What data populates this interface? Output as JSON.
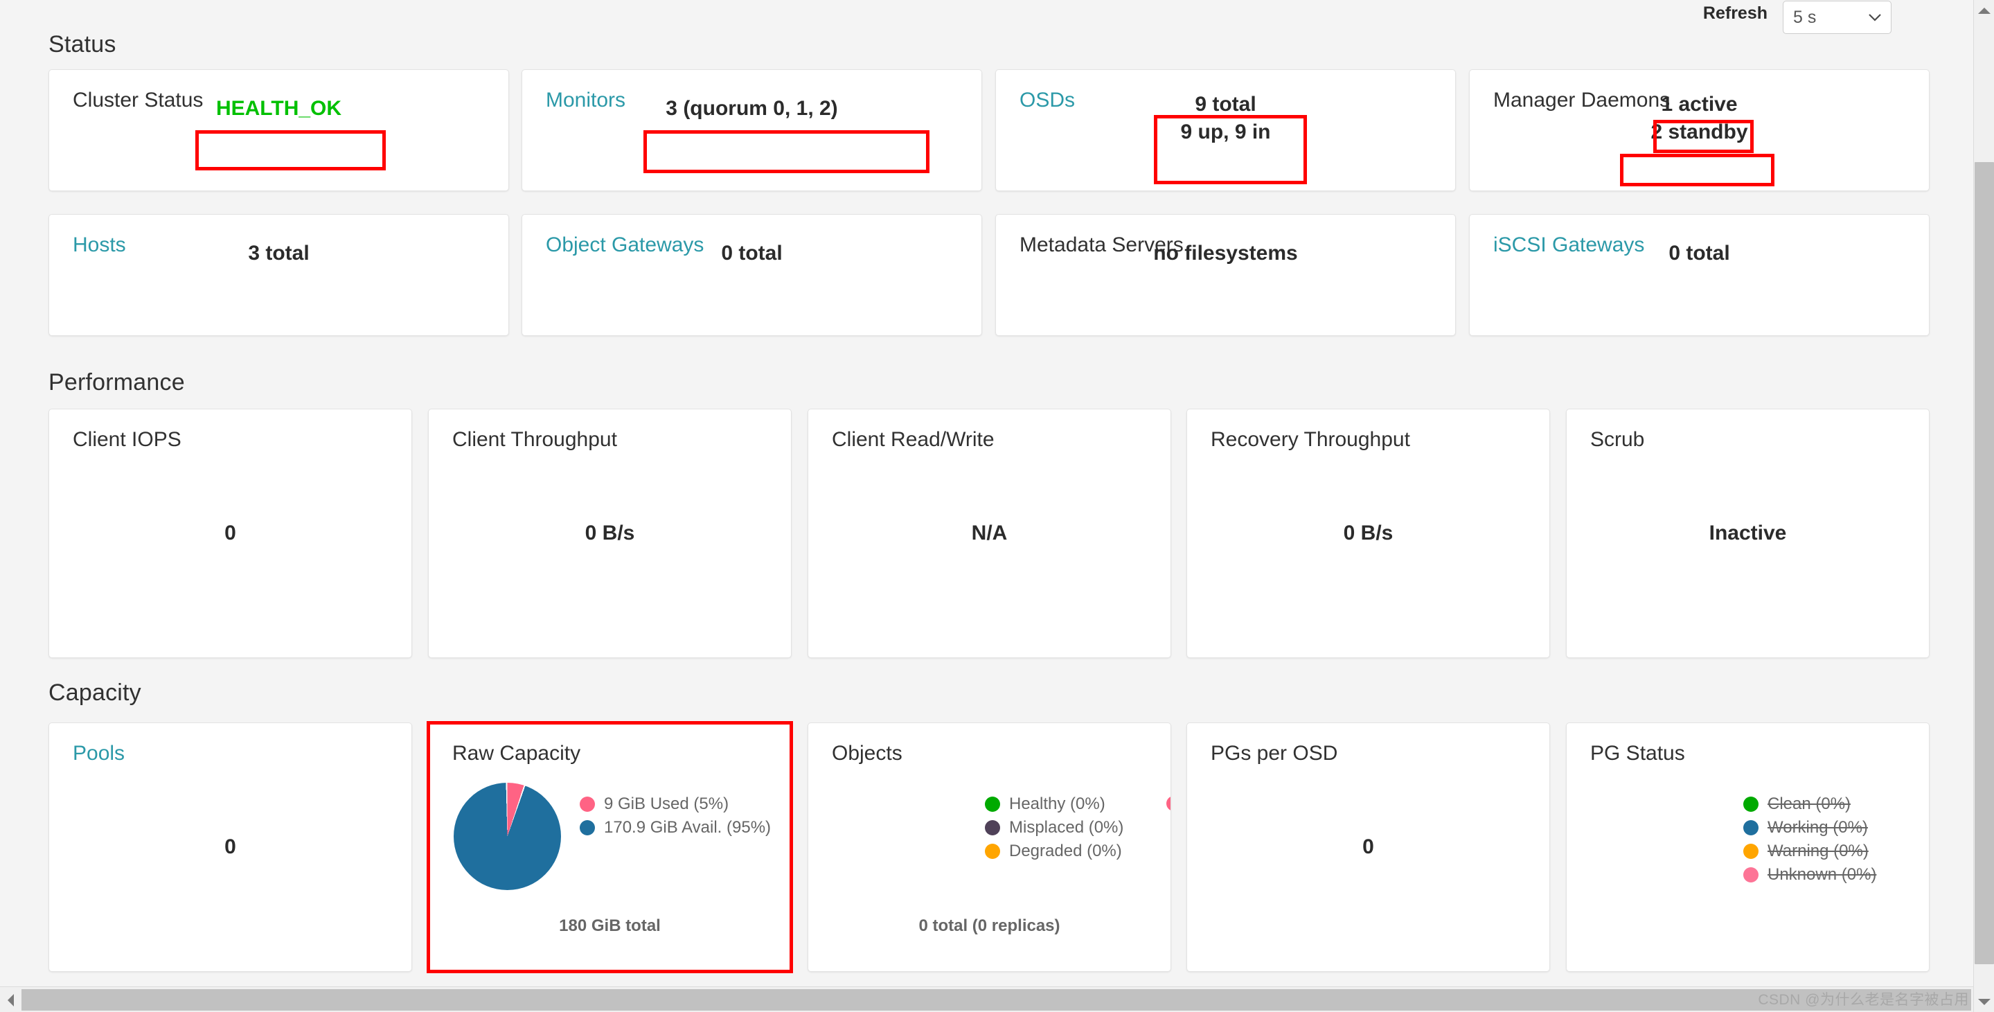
{
  "toolbar": {
    "refresh_label": "Refresh",
    "refresh_value": "5 s",
    "chevron_icon": "chevron-down-icon"
  },
  "sections": {
    "status": "Status",
    "performance": "Performance",
    "capacity": "Capacity"
  },
  "status_cards": [
    {
      "title": "Cluster Status",
      "value": "HEALTH_OK",
      "is_link": false,
      "value_color": "#00c000"
    },
    {
      "title": "Monitors",
      "value": "3 (quorum 0, 1, 2)",
      "is_link": true
    },
    {
      "title": "OSDs",
      "value": "9 total\n9 up, 9 in",
      "is_link": true
    },
    {
      "title": "Manager Daemons",
      "value": "1 active\n2 standby",
      "is_link": false
    },
    {
      "title": "Hosts",
      "value": "3 total",
      "is_link": true
    },
    {
      "title": "Object Gateways",
      "value": "0 total",
      "is_link": true
    },
    {
      "title": "Metadata Servers",
      "value": "no filesystems",
      "is_link": false
    },
    {
      "title": "iSCSI Gateways",
      "value": "0 total",
      "is_link": true
    }
  ],
  "performance_cards": [
    {
      "title": "Client IOPS",
      "value": "0"
    },
    {
      "title": "Client Throughput",
      "value": "0 B/s"
    },
    {
      "title": "Client Read/Write",
      "value": "N/A"
    },
    {
      "title": "Recovery Throughput",
      "value": "0 B/s"
    },
    {
      "title": "Scrub",
      "value": "Inactive"
    }
  ],
  "capacity_cards": {
    "pools": {
      "title": "Pools",
      "value": "0",
      "is_link": true
    },
    "raw": {
      "title": "Raw Capacity",
      "total": "180 GiB total"
    },
    "objects": {
      "title": "Objects",
      "total": "0 total (0 replicas)"
    },
    "pgs_per_osd": {
      "title": "PGs per OSD",
      "value": "0"
    },
    "pg_status": {
      "title": "PG Status"
    }
  },
  "chart_data": [
    {
      "type": "pie",
      "title": "Raw Capacity",
      "categories": [
        "9 GiB Used (5%)",
        "170.9 GiB Avail. (95%)"
      ],
      "values": [
        5,
        95
      ],
      "colors": [
        "#ff6384",
        "#1f6f9e"
      ],
      "total_label": "180 GiB total",
      "legend_position": "right"
    },
    {
      "type": "pie",
      "title": "Objects",
      "categories": [
        "Healthy (0%)",
        "Misplaced (0%)",
        "Degraded (0%)"
      ],
      "values": [
        0,
        0,
        0
      ],
      "colors": [
        "#00aa00",
        "#4f4158",
        "#ffa500"
      ],
      "total_label": "0 total (0 replicas)",
      "legend_position": "right",
      "clipped_swatch_color": "#ff6384"
    },
    {
      "type": "pie",
      "title": "PG Status",
      "categories": [
        "Clean (0%)",
        "Working (0%)",
        "Warning (0%)",
        "Unknown (0%)"
      ],
      "values": [
        0,
        0,
        0,
        0
      ],
      "colors": [
        "#00aa00",
        "#1f6f9e",
        "#ffa500",
        "#fd7496"
      ],
      "disabled": [
        true,
        true,
        true,
        true
      ],
      "legend_position": "right"
    }
  ],
  "watermark": "CSDN @为什么老是名字被占用"
}
